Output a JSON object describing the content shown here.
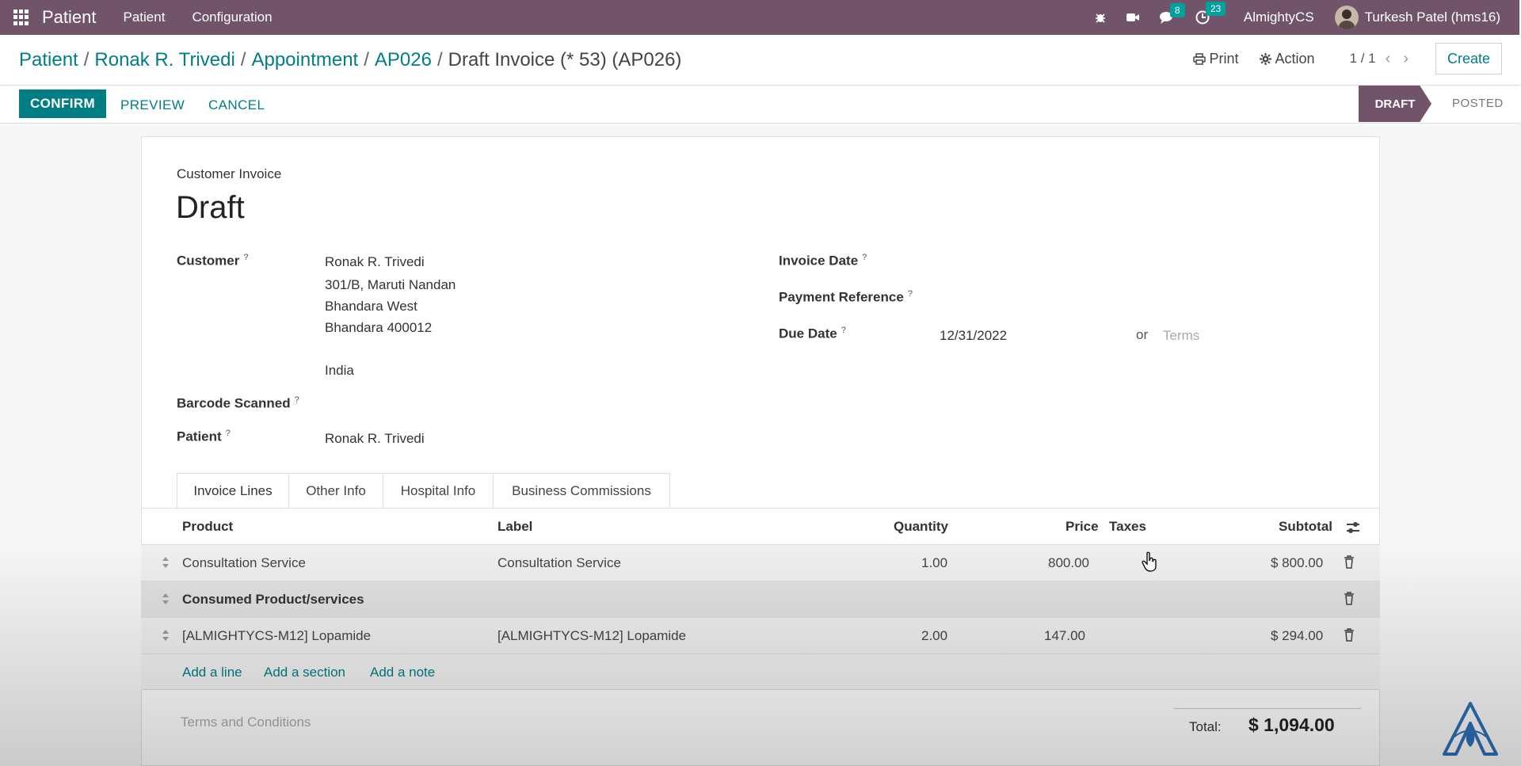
{
  "topbar": {
    "brand": "Patient",
    "menu": [
      "Patient",
      "Configuration"
    ],
    "messages_count": "8",
    "activities_count": "23",
    "company": "AlmightyCS",
    "user": "Turkesh Patel (hms16)"
  },
  "breadcrumb": [
    {
      "label": "Patient",
      "link": true
    },
    {
      "label": "Ronak R. Trivedi",
      "link": true
    },
    {
      "label": "Appointment",
      "link": true
    },
    {
      "label": "AP026",
      "link": true
    },
    {
      "label": "Draft Invoice (* 53) (AP026)",
      "link": false
    }
  ],
  "control": {
    "print": "Print",
    "action": "Action",
    "pager": "1 / 1",
    "create": "Create"
  },
  "statusbar": {
    "confirm": "CONFIRM",
    "preview": "PREVIEW",
    "cancel": "CANCEL",
    "states": [
      "DRAFT",
      "POSTED"
    ],
    "active_state": "DRAFT"
  },
  "invoice": {
    "type": "Customer Invoice",
    "state": "Draft",
    "customer_label": "Customer",
    "customer_lines": [
      "Ronak R. Trivedi",
      "301/B, Maruti Nandan",
      "Bhandara West",
      "Bhandara 400012",
      "India"
    ],
    "barcode_label": "Barcode Scanned",
    "patient_label": "Patient",
    "patient": "Ronak R. Trivedi",
    "invoice_date_label": "Invoice Date",
    "payment_reference_label": "Payment Reference",
    "due_date_label": "Due Date",
    "due_date": "12/31/2022",
    "or": "or",
    "terms_placeholder": "Terms"
  },
  "tabs": [
    "Invoice Lines",
    "Other Info",
    "Hospital Info",
    "Business Commissions"
  ],
  "table": {
    "headers": {
      "product": "Product",
      "label": "Label",
      "quantity": "Quantity",
      "price": "Price",
      "taxes": "Taxes",
      "subtotal": "Subtotal"
    },
    "rows": [
      {
        "product": "Consultation Service",
        "label": "Consultation Service",
        "quantity": "1.00",
        "price": "800.00",
        "subtotal": "$ 800.00"
      },
      {
        "section": "Consumed Product/services"
      },
      {
        "product": "[ALMIGHTYCS-M12] Lopamide",
        "label": "[ALMIGHTYCS-M12] Lopamide",
        "quantity": "2.00",
        "price": "147.00",
        "subtotal": "$ 294.00"
      }
    ],
    "add_links": [
      "Add a line",
      "Add a section",
      "Add a note"
    ]
  },
  "footer": {
    "terms_placeholder": "Terms and Conditions",
    "total_label": "Total:",
    "total_value": "$ 1,094.00"
  },
  "colors": {
    "navbar": "#71546a",
    "accent": "#017e84",
    "badge": "#00a09d"
  }
}
